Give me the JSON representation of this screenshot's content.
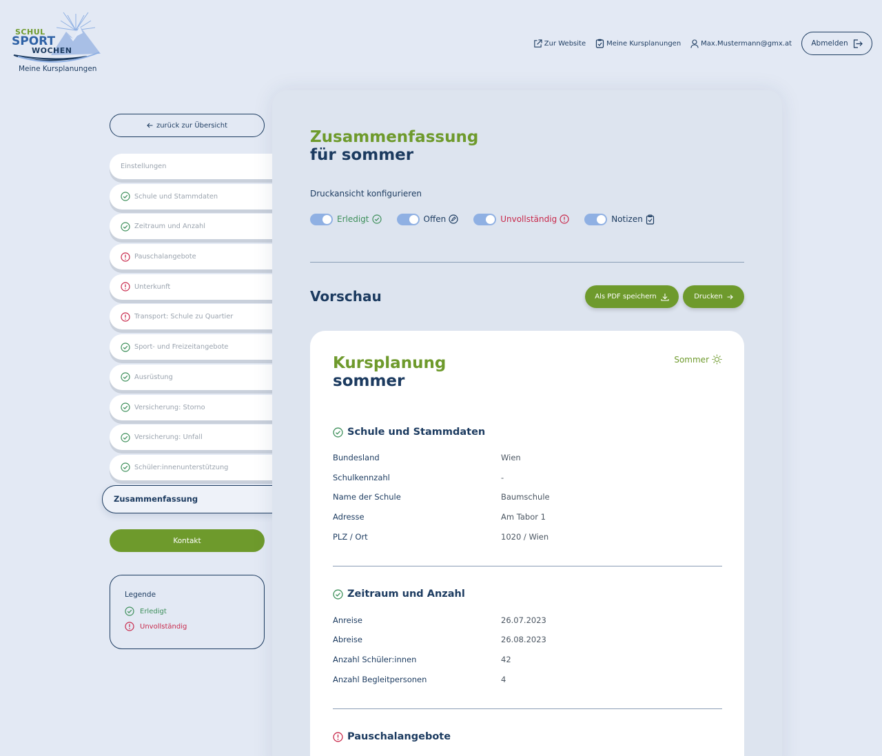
{
  "brand": {
    "logo_line1": "SCHUL",
    "logo_line2": "SPORT",
    "logo_line3": "WOCHEN",
    "subtitle": "Meine Kursplanungen"
  },
  "topnav": {
    "website": "Zur Website",
    "kursplanungen": "Meine Kursplanungen",
    "user_email": "Max.Mustermann@gmx.at",
    "logout": "Abmelden"
  },
  "sidebar": {
    "back": "zurück zur Übersicht",
    "items": [
      {
        "label": "Einstellungen",
        "status": "none"
      },
      {
        "label": "Schule und Stammdaten",
        "status": "done"
      },
      {
        "label": "Zeitraum und Anzahl",
        "status": "done"
      },
      {
        "label": "Pauschalangebote",
        "status": "incomplete"
      },
      {
        "label": "Unterkunft",
        "status": "incomplete"
      },
      {
        "label": "Transport: Schule zu Quartier",
        "status": "incomplete"
      },
      {
        "label": "Sport- und Freizeitangebote",
        "status": "done"
      },
      {
        "label": "Ausrüstung",
        "status": "done"
      },
      {
        "label": "Versicherung: Storno",
        "status": "done"
      },
      {
        "label": "Versicherung: Unfall",
        "status": "done"
      },
      {
        "label": "Schüler:innenunterstützung",
        "status": "done"
      },
      {
        "label": "Zusammenfassung",
        "status": "active"
      }
    ],
    "kontakt": "Kontakt",
    "legend": {
      "title": "Legende",
      "done": "Erledigt",
      "incomplete": "Unvollständig"
    }
  },
  "main": {
    "title_line1": "Zusammenfassung",
    "title_line2": "für sommer",
    "config_label": "Druckansicht konfigurieren",
    "toggles": {
      "erledigt": "Erledigt",
      "offen": "Offen",
      "unvollstaendig": "Unvollständig",
      "notizen": "Notizen"
    },
    "preview_title": "Vorschau",
    "pdf_button": "Als PDF speichern",
    "print_button": "Drucken"
  },
  "preview": {
    "title_line1": "Kursplanung",
    "title_line2": "sommer",
    "season": "Sommer",
    "sections": [
      {
        "title": "Schule und Stammdaten",
        "rows": [
          {
            "k": "Bundesland",
            "v": "Wien"
          },
          {
            "k": "Schulkennzahl",
            "v": "-"
          },
          {
            "k": "Name der Schule",
            "v": "Baumschule"
          },
          {
            "k": "Adresse",
            "v": "Am Tabor 1"
          },
          {
            "k": "PLZ / Ort",
            "v": "1020 / Wien"
          }
        ]
      },
      {
        "title": "Zeitraum und Anzahl",
        "rows": [
          {
            "k": "Anreise",
            "v": "26.07.2023"
          },
          {
            "k": "Abreise",
            "v": "26.08.2023"
          },
          {
            "k": "Anzahl Schüler:innen",
            "v": "42"
          },
          {
            "k": "Anzahl Begleitpersonen",
            "v": "4"
          }
        ]
      },
      {
        "title": "Pauschalangebote",
        "rows": []
      }
    ]
  },
  "colors": {
    "green": "#6e9a2c",
    "navy": "#1b3a5f",
    "done": "#3d8f5a",
    "incomplete": "#c8284a",
    "background": "#e3e9f4"
  }
}
